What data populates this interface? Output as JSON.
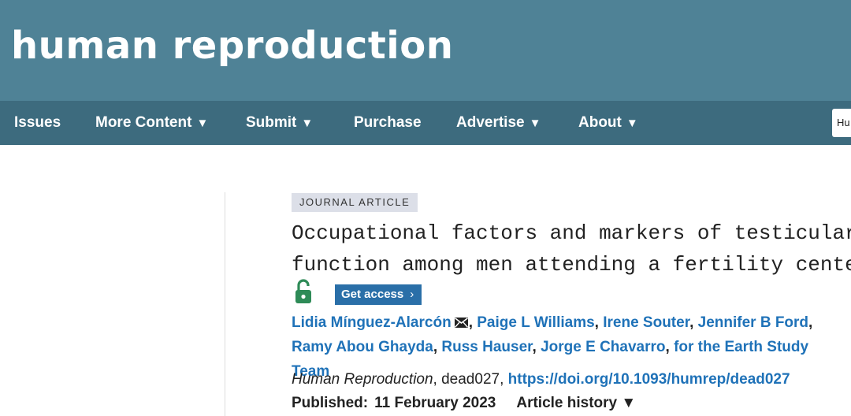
{
  "header": {
    "site_title": "human reproduction"
  },
  "nav": {
    "items": [
      {
        "label": "Issues",
        "caret": ""
      },
      {
        "label": "More Content",
        "caret": "▼"
      },
      {
        "label": "Submit",
        "caret": "▼"
      },
      {
        "label": "Purchase",
        "caret": ""
      },
      {
        "label": "Advertise",
        "caret": "▼"
      },
      {
        "label": "About",
        "caret": "▼"
      }
    ],
    "search_value": "Hu"
  },
  "article": {
    "type_badge": "JOURNAL ARTICLE",
    "title_line1": "Occupational factors and markers of testicular",
    "title_line2": "function among men attending a fertility center",
    "access_icon": "open-lock-icon",
    "get_access_label": "Get access",
    "get_access_chevron": "›",
    "authors": [
      "Lidia Mínguez-Alarcón",
      "Paige L Williams",
      "Irene Souter",
      "Jennifer B Ford",
      "Ramy Abou Ghayda",
      "Russ Hauser",
      "Jorge E Chavarro",
      "for the Earth Study Team"
    ],
    "separator": ",",
    "journal_name": "Human Reproduction",
    "article_id": "dead027",
    "doi": "https://doi.org/10.1093/humrep/dead027",
    "published_label": "Published:",
    "published_date": "11 February 2023",
    "history_label": "Article history ▼"
  },
  "colors": {
    "banner": "#4f8296",
    "nav": "#3d6b7e",
    "link": "#1f72b8",
    "access_button": "#2a6fa8",
    "lock": "#2e8b57"
  }
}
